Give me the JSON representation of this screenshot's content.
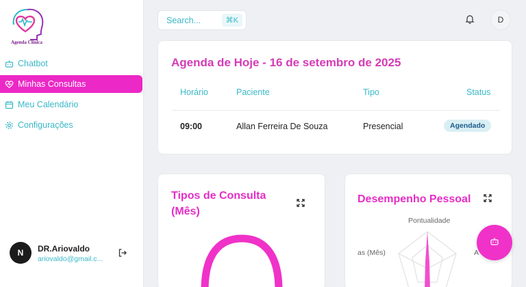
{
  "brand": {
    "logo_text": "Agenda Clínica"
  },
  "sidebar": {
    "items": [
      {
        "label": "Chatbot",
        "icon": "bot-icon",
        "active": false
      },
      {
        "label": "Minhas Consultas",
        "icon": "heart-icon",
        "active": true
      },
      {
        "label": "Meu Calendário",
        "icon": "calendar-icon",
        "active": false
      },
      {
        "label": "Configurações",
        "icon": "gear-icon",
        "active": false
      }
    ]
  },
  "user": {
    "initial": "N",
    "name": "DR.Ariovaldo",
    "email": "ariovaldo@gmail.c..."
  },
  "topbar": {
    "search_label": "Search...",
    "shortcut": "⌘K",
    "avatar_initial": "D"
  },
  "agenda": {
    "title": "Agenda de Hoje - 16 de setembro de 2025",
    "columns": [
      "Horário",
      "Paciente",
      "Tipo",
      "Status"
    ],
    "rows": [
      {
        "time": "09:00",
        "patient": "Allan Ferreira De Souza",
        "type": "Presencial",
        "status": "Agendado"
      }
    ]
  },
  "tipos": {
    "title": "Tipos de Consulta (Mês)"
  },
  "desempenho": {
    "title": "Desempenho Pessoal",
    "axis_top": "Pontualidade",
    "axis_left": "as (Mês)",
    "axis_right": "A"
  },
  "colors": {
    "accent": "#ec28c6",
    "teal": "#39b8c7",
    "badge_bg": "#d9eff4"
  }
}
